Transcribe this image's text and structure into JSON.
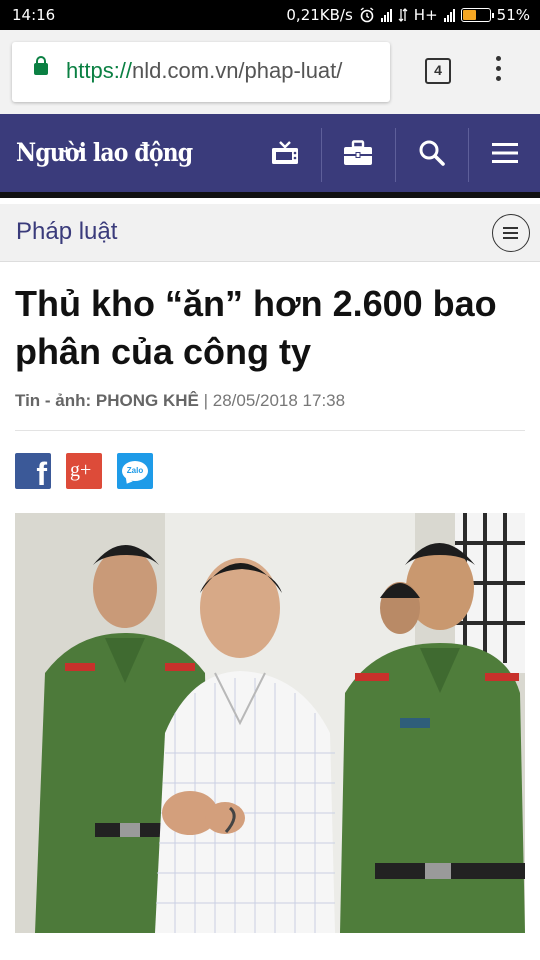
{
  "status_bar": {
    "time": "14:16",
    "network_speed": "0,21KB/s",
    "network_type": "H+",
    "battery": "51%",
    "battery_level": 0.51
  },
  "browser": {
    "url_scheme": "https://",
    "url_rest": "nld.com.vn/phap-luat/",
    "tab_count": "4"
  },
  "site": {
    "logo": "Người lao động",
    "header_icons": [
      "tv-icon",
      "briefcase-icon",
      "search-icon",
      "hamburger-menu-icon"
    ]
  },
  "section": {
    "title": "Pháp luật"
  },
  "article": {
    "headline": "Thủ kho “ăn” hơn 2.600 bao phân của công ty",
    "byline_label": "Tin - ảnh: PHONG KHÊ",
    "byline_separator": " | ",
    "date": "28/05/2018 17:38",
    "share": {
      "facebook_glyph": "f",
      "googleplus_glyph": "g+",
      "zalo_label": "Zalo"
    }
  },
  "colors": {
    "brand": "#3a3b7b",
    "secure_green": "#0b8043",
    "facebook": "#3b5998",
    "googleplus": "#dd4b39",
    "zalo": "#1e9be8"
  }
}
